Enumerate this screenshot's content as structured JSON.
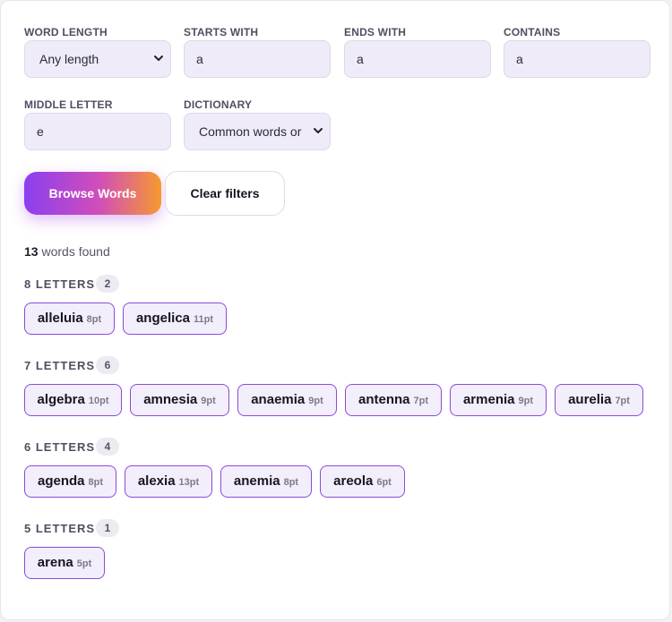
{
  "filters": {
    "word_length": {
      "label": "WORD LENGTH",
      "value": "Any length"
    },
    "starts_with": {
      "label": "STARTS WITH",
      "value": "a"
    },
    "ends_with": {
      "label": "ENDS WITH",
      "value": "a"
    },
    "contains": {
      "label": "CONTAINS",
      "value": "a"
    },
    "middle_letter": {
      "label": "MIDDLE LETTER",
      "value": "e"
    },
    "dictionary": {
      "label": "DICTIONARY",
      "value": "Common words or"
    }
  },
  "actions": {
    "browse_label": "Browse Words",
    "clear_label": "Clear filters"
  },
  "results": {
    "count": "13",
    "count_suffix": " words found",
    "groups": [
      {
        "title": "8 LETTERS",
        "count": "2",
        "words": [
          {
            "word": "alleluia",
            "points": "8pt"
          },
          {
            "word": "angelica",
            "points": "11pt"
          }
        ]
      },
      {
        "title": "7 LETTERS",
        "count": "6",
        "words": [
          {
            "word": "algebra",
            "points": "10pt"
          },
          {
            "word": "amnesia",
            "points": "9pt"
          },
          {
            "word": "anaemia",
            "points": "9pt"
          },
          {
            "word": "antenna",
            "points": "7pt"
          },
          {
            "word": "armenia",
            "points": "9pt"
          },
          {
            "word": "aurelia",
            "points": "7pt"
          }
        ]
      },
      {
        "title": "6 LETTERS",
        "count": "4",
        "words": [
          {
            "word": "agenda",
            "points": "8pt"
          },
          {
            "word": "alexia",
            "points": "13pt"
          },
          {
            "word": "anemia",
            "points": "8pt"
          },
          {
            "word": "areola",
            "points": "6pt"
          }
        ]
      },
      {
        "title": "5 LETTERS",
        "count": "1",
        "words": [
          {
            "word": "arena",
            "points": "5pt"
          }
        ]
      }
    ]
  },
  "colors": {
    "accent_start": "#8b3ff0",
    "accent_mid": "#d14eb9",
    "accent_end": "#f79a2f",
    "chip_border": "#8a4bd9",
    "chip_bg": "#f3eefb",
    "field_bg": "#efebf8"
  }
}
